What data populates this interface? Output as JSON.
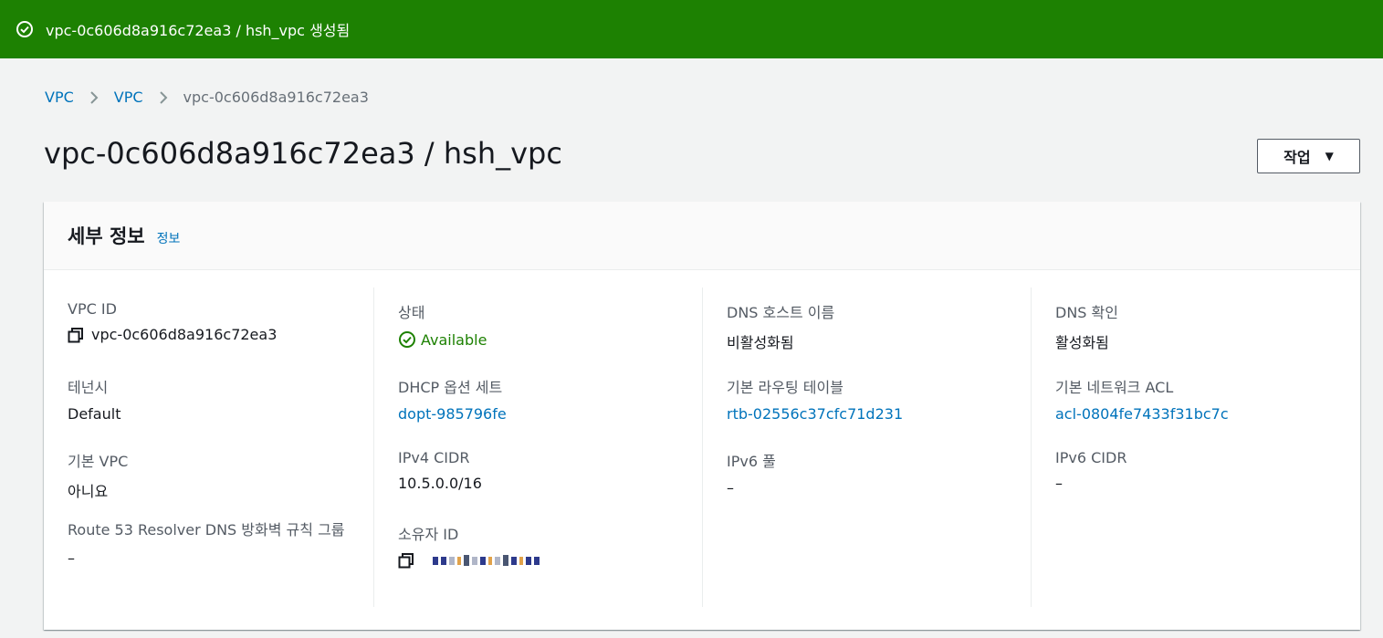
{
  "flash": {
    "message": "vpc-0c606d8a916c72ea3 / hsh_vpc 생성됨",
    "color": "#1d8102"
  },
  "breadcrumb": {
    "items": [
      "VPC",
      "VPC"
    ],
    "current": "vpc-0c606d8a916c72ea3"
  },
  "page": {
    "title": "vpc-0c606d8a916c72ea3 / hsh_vpc",
    "actions_label": "작업"
  },
  "details": {
    "title": "세부 정보",
    "info_link": "정보",
    "col1": {
      "vpc_id_label": "VPC ID",
      "vpc_id_value": "vpc-0c606d8a916c72ea3",
      "tenancy_label": "테넌시",
      "tenancy_value": "Default",
      "default_vpc_label": "기본 VPC",
      "default_vpc_value": "아니요",
      "resolver_label": "Route 53 Resolver DNS 방화벽 규칙 그룹",
      "resolver_value": "–"
    },
    "col2": {
      "state_label": "상태",
      "state_value": "Available",
      "dhcp_label": "DHCP 옵션 세트",
      "dhcp_value": "dopt-985796fe",
      "ipv4_label": "IPv4 CIDR",
      "ipv4_value": "10.5.0.0/16",
      "owner_label": "소유자 ID"
    },
    "col3": {
      "dns_hostnames_label": "DNS 호스트 이름",
      "dns_hostnames_value": "비활성화됨",
      "main_route_label": "기본 라우팅 테이블",
      "main_route_value": "rtb-02556c37cfc71d231",
      "ipv6_pool_label": "IPv6 풀",
      "ipv6_pool_value": "–"
    },
    "col4": {
      "dns_resolution_label": "DNS 확인",
      "dns_resolution_value": "활성화됨",
      "main_acl_label": "기본 네트워크 ACL",
      "main_acl_value": "acl-0804fe7433f31bc7c",
      "ipv6_cidr_label": "IPv6 CIDR",
      "ipv6_cidr_value": "–"
    }
  },
  "colors": {
    "link": "#0073bb",
    "success": "#1d8102",
    "label": "#545b64",
    "text": "#16191f"
  },
  "icons": {
    "flash": "check-circle-icon",
    "separator": "chevron-right-icon",
    "caret": "caret-down-icon",
    "copy": "copy-icon",
    "status": "check-circle-icon"
  }
}
